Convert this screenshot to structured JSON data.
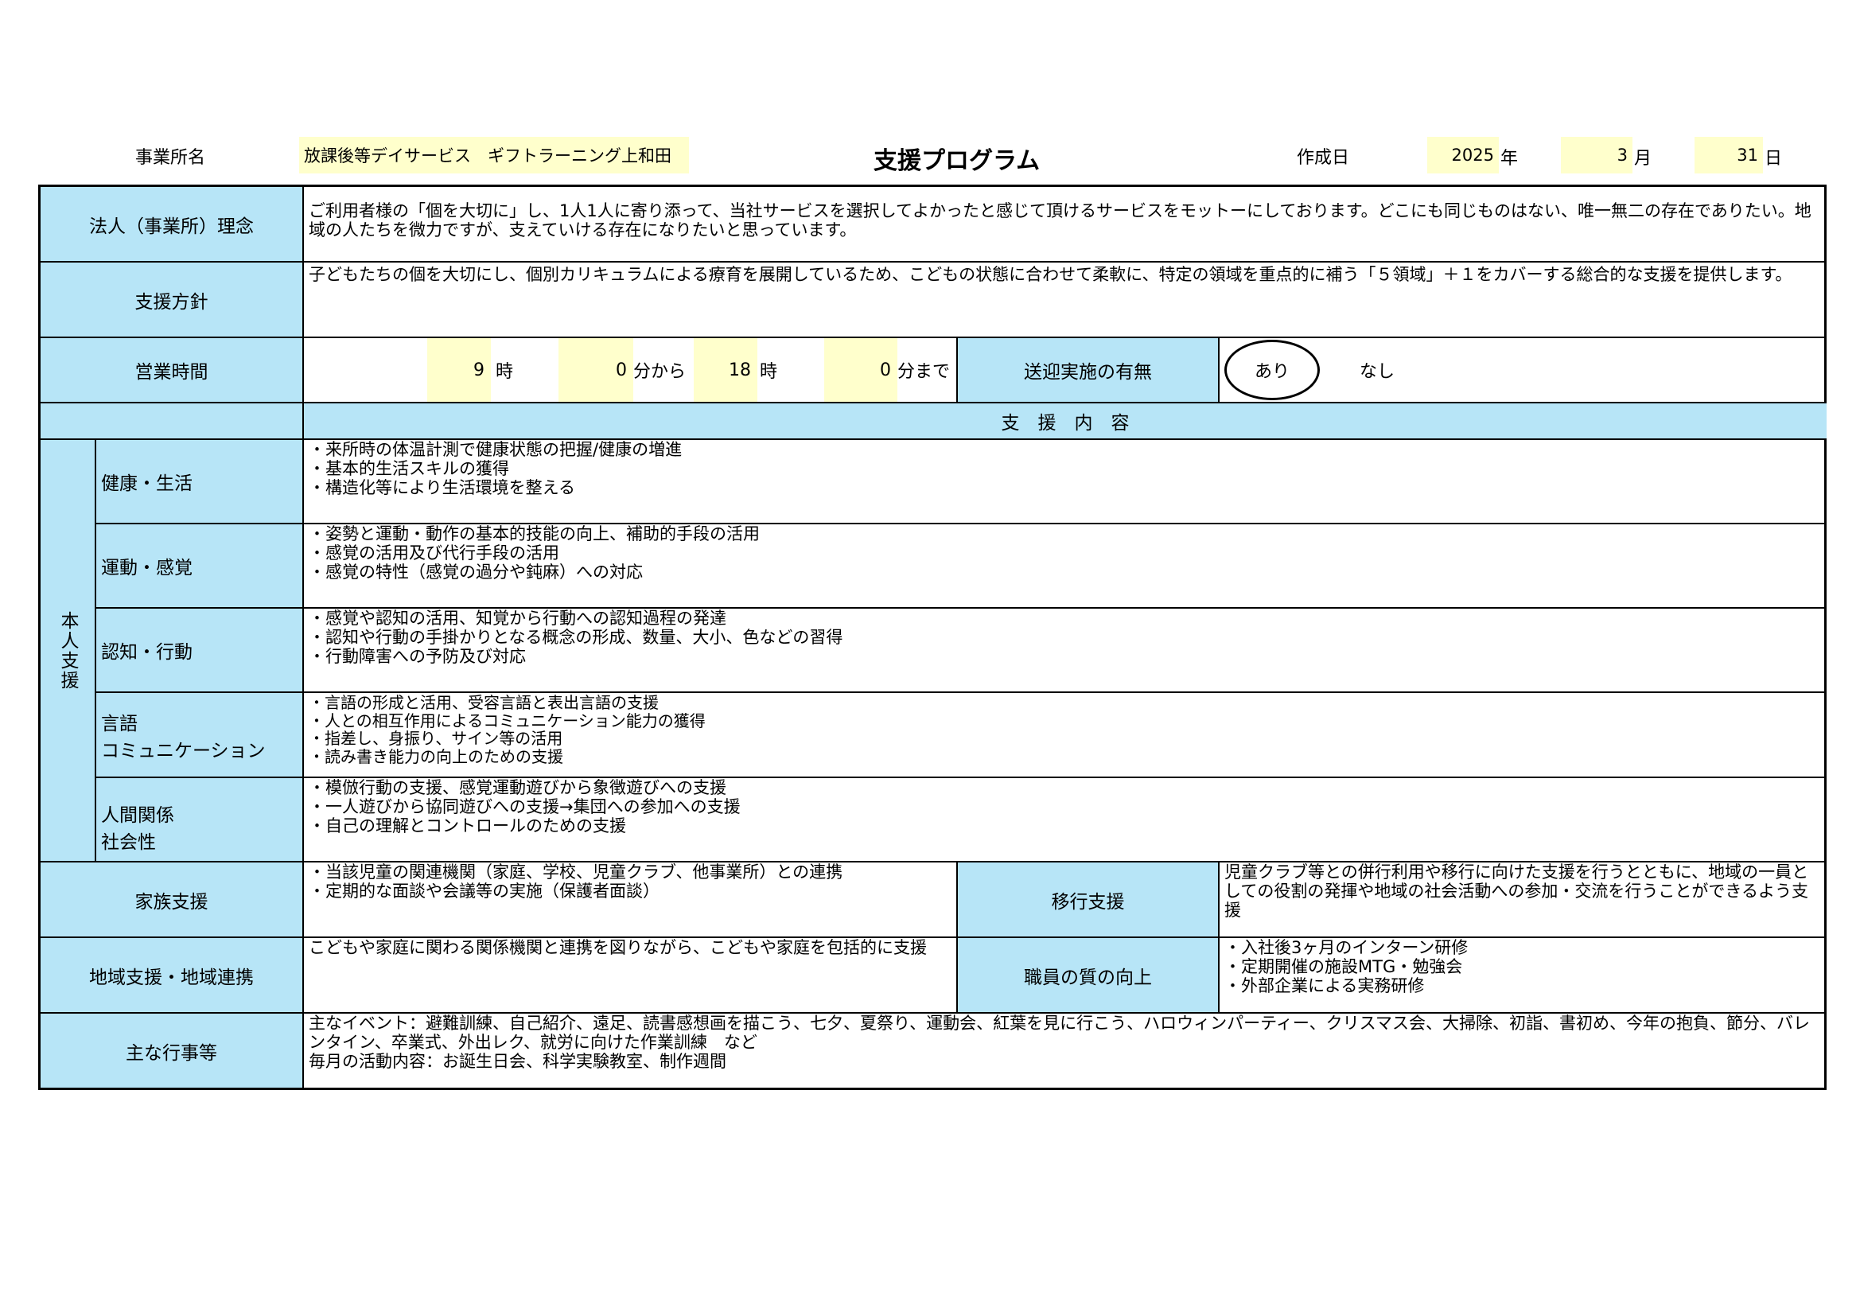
{
  "header": {
    "office_label": "事業所名",
    "office_name": "放課後等デイサービス　ギフトラーニング上和田",
    "title": "支援プログラム",
    "date_label": "作成日",
    "year": "2025",
    "year_unit": "年",
    "month": "3",
    "month_unit": "月",
    "day": "31",
    "day_unit": "日"
  },
  "philosophy": {
    "label": "法人（事業所）理念",
    "text": "ご利用者様の「個を大切に」し、1人1人に寄り添って、当社サービスを選択してよかったと感じて頂けるサービスをモットーにしております。どこにも同じものはない、唯一無二の存在でありたい。地域の人たちを微力ですが、支えていける存在になりたいと思っています。"
  },
  "policy": {
    "label": "支援方針",
    "text": "子どもたちの個を大切にし、個別カリキュラムによる療育を展開しているため、こどもの状態に合わせて柔軟に、特定の領域を重点的に補う「５領域」＋１をカバーする総合的な支援を提供します。"
  },
  "hours": {
    "label": "営業時間",
    "start_hour": "9",
    "hour_unit": "時",
    "start_min": "0",
    "min_from": "分から",
    "end_hour": "18",
    "end_min": "0",
    "min_until": "分まで",
    "transport_label": "送迎実施の有無",
    "transport_yes": "あり",
    "transport_no": "なし"
  },
  "content_header": "支　援　内　容",
  "self_support": {
    "label": "本人支援",
    "domains": [
      {
        "label": "健康・生活",
        "lines": [
          "・来所時の体温計測で健康状態の把握/健康の増進",
          "・基本的生活スキルの獲得",
          "・構造化等により生活環境を整える"
        ]
      },
      {
        "label": "運動・感覚",
        "lines": [
          "・姿勢と運動・動作の基本的技能の向上、補助的手段の活用",
          "・感覚の活用及び代行手段の活用",
          "・感覚の特性（感覚の過分や鈍麻）への対応"
        ]
      },
      {
        "label": "認知・行動",
        "lines": [
          "・感覚や認知の活用、知覚から行動への認知過程の発達",
          "・認知や行動の手掛かりとなる概念の形成、数量、大小、色などの習得",
          "・行動障害への予防及び対応"
        ]
      },
      {
        "label": "言語\nコミュニケーション",
        "label_line1": "言語",
        "label_line2": "コミュニケーション",
        "lines": [
          "・言語の形成と活用、受容言語と表出言語の支援",
          "・人との相互作用によるコミュニケーション能力の獲得",
          "・指差し、身振り、サイン等の活用",
          "・読み書き能力の向上のための支援"
        ]
      },
      {
        "label": "人間関係\n社会性",
        "label_line1": "人間関係",
        "label_line2": "社会性",
        "lines": [
          "・模倣行動の支援、感覚運動遊びから象徴遊びへの支援",
          "・一人遊びから協同遊びへの支援→集団への参加への支援",
          "・自己の理解とコントロールのための支援"
        ]
      }
    ]
  },
  "family": {
    "label": "家族支援",
    "lines": [
      "・当該児童の関連機関（家庭、学校、児童クラブ、他事業所）との連携",
      "・定期的な面談や会議等の実施（保護者面談）"
    ]
  },
  "transition": {
    "label": "移行支援",
    "text": "児童クラブ等との併行利用や移行に向けた支援を行うとともに、地域の一員としての役割の発揮や地域の社会活動への参加・交流を行うことができるよう支援"
  },
  "community": {
    "label": "地域支援・地域連携",
    "text": "こどもや家庭に関わる関係機関と連携を図りながら、こどもや家庭を包括的に支援"
  },
  "staff": {
    "label": "職員の質の向上",
    "lines": [
      "・入社後3ヶ月のインターン研修",
      "・定期開催の施設MTG・勉強会",
      "・外部企業による実務研修"
    ]
  },
  "events": {
    "label": "主な行事等",
    "text1": "主なイベント：避難訓練、自己紹介、遠足、読書感想画を描こう、七夕、夏祭り、運動会、紅葉を見に行こう、ハロウィンパーティー、クリスマス会、大掃除、初詣、書初め、今年の抱負、節分、バレンタイン、卒業式、外出レク、就労に向けた作業訓練　など",
    "text2": "毎月の活動内容：お誕生日会、科学実験教室、制作週間"
  },
  "colors": {
    "label_bg": "#b7e5f7",
    "input_bg": "#ffffcc",
    "border": "#000000"
  }
}
